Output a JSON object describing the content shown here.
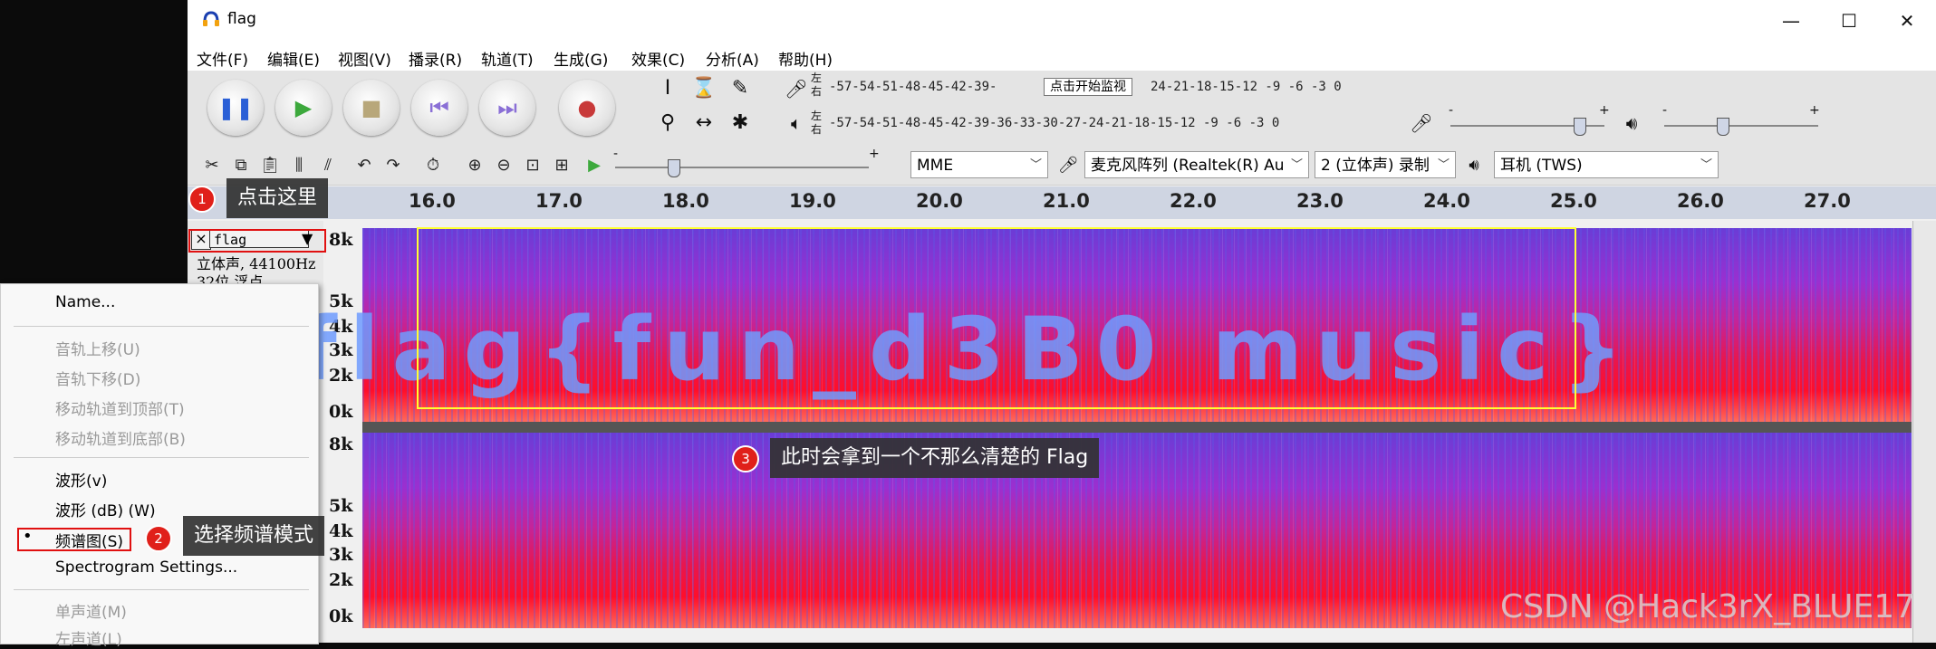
{
  "window": {
    "title": "flag"
  },
  "menu": [
    "文件(F)",
    "编辑(E)",
    "视图(V)",
    "播录(R)",
    "轨道(T)",
    "生成(G)",
    "效果(C)",
    "分析(A)",
    "帮助(H)"
  ],
  "meters": {
    "record_scale": "-57-54-51-48-45-42-39-",
    "record_scale_tail": "24-21-18-15-12 -9 -6 -3 0",
    "monitor_button": "点击开始监视",
    "play_scale": "-57-54-51-48-45-42-39-36-33-30-27-24-21-18-15-12 -9 -6 -3 0",
    "lr_left": "左",
    "lr_right": "右",
    "minus": "-",
    "plus": "+"
  },
  "devices": {
    "host": "MME",
    "input": "麦克风阵列 (Realtek(R) Au",
    "channels": "2 (立体声) 录制",
    "output": "耳机 (TWS)"
  },
  "ruler": [
    "16.0",
    "17.0",
    "18.0",
    "19.0",
    "20.0",
    "21.0",
    "22.0",
    "23.0",
    "24.0",
    "25.0",
    "26.0",
    "27.0"
  ],
  "track": {
    "name": "flag",
    "info1": "立体声, 44100Hz",
    "info2": "32位 浮点",
    "close": "×",
    "dropdown": "▼"
  },
  "yaxis": {
    "top": [
      "8k",
      "5k",
      "4k",
      "3k",
      "2k",
      "0k"
    ],
    "bottom": [
      "8k",
      "5k",
      "4k",
      "3k",
      "2k",
      "0k"
    ]
  },
  "spectrogram_text": "flag{fun_d3B0 music}",
  "context_menu": {
    "name": "Name...",
    "move_up": "音轨上移(U)",
    "move_down": "音轨下移(D)",
    "move_top": "移动轨道到顶部(T)",
    "move_bottom": "移动轨道到底部(B)",
    "waveform": "波形(v)",
    "waveform_db": "波形 (dB) (W)",
    "spectrogram": "频谱图(S)",
    "spectrogram_settings": "Spectrogram Settings...",
    "mono": "单声道(M)",
    "left": "左声道(L)",
    "bullet": "•"
  },
  "callouts": {
    "c1_num": "1",
    "c1_text": "点击这里",
    "c2_num": "2",
    "c2_text": "选择频谱模式",
    "c3_num": "3",
    "c3_text": "此时会拿到一个不那么清楚的 Flag"
  },
  "watermark": "CSDN @Hack3rX_BLUE17",
  "colors": {
    "accent_red": "#e01010",
    "highlight_yellow": "#ffff33"
  }
}
